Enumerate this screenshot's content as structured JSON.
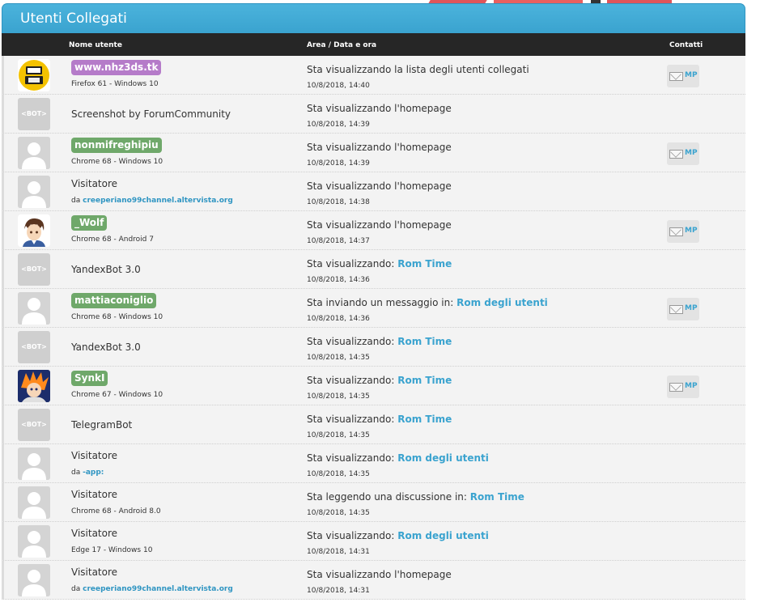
{
  "panel": {
    "title": "Utenti Collegati"
  },
  "headers": {
    "user": "Nome utente",
    "area": "Area / Data e ora",
    "contacts": "Contatti"
  },
  "colors": {
    "accent": "#3aa3cf",
    "purple_badge": "#b57bc9",
    "green_badge": "#6fa86a",
    "header_bg": "#262626"
  },
  "rows": [
    {
      "avatar": "3ds-icon",
      "name": "www.nhz3ds.tk",
      "sub": "Firefox 61 - Windows 10",
      "action": "Sta visualizzando la lista degli utenti collegati",
      "link": "",
      "time": "10/8/2018, 14:40",
      "mp": "MP"
    },
    {
      "avatar": "bot",
      "bot_label": "<BOT>",
      "name": "Screenshot by ForumCommunity",
      "sub": "",
      "action": "Sta visualizzando l'homepage",
      "link": "",
      "time": "10/8/2018, 14:39"
    },
    {
      "avatar": "default",
      "name": "nonmifreghipiu",
      "sub": "Chrome 68 - Windows 10",
      "action": "Sta visualizzando l'homepage",
      "link": "",
      "time": "10/8/2018, 14:39",
      "mp": "MP"
    },
    {
      "avatar": "default",
      "name": "Visitatore",
      "sub_prefix": "da",
      "sub_origin": "creeperiano99channel.altervista.org",
      "action": "Sta visualizzando l'homepage",
      "link": "",
      "time": "10/8/2018, 14:38"
    },
    {
      "avatar": "anime-boy",
      "name": "_Wolf",
      "sub": "Chrome 68 - Android 7",
      "action": "Sta visualizzando l'homepage",
      "link": "",
      "time": "10/8/2018, 14:37",
      "mp": "MP"
    },
    {
      "avatar": "bot",
      "bot_label": "<BOT>",
      "name": "YandexBot 3.0",
      "sub": "",
      "action": "Sta visualizzando:",
      "link": "Rom Time",
      "time": "10/8/2018, 14:36"
    },
    {
      "avatar": "default",
      "name": "mattiaconiglio",
      "sub": "Chrome 68 - Windows 10",
      "action": "Sta inviando un messaggio in:",
      "link": "Rom degli utenti",
      "time": "10/8/2018, 14:36",
      "mp": "MP"
    },
    {
      "avatar": "bot",
      "bot_label": "<BOT>",
      "name": "YandexBot 3.0",
      "sub": "",
      "action": "Sta visualizzando:",
      "link": "Rom Time",
      "time": "10/8/2018, 14:35"
    },
    {
      "avatar": "anime-orange",
      "name": "SynkI",
      "sub": "Chrome 67 - Windows 10",
      "action": "Sta visualizzando:",
      "link": "Rom Time",
      "time": "10/8/2018, 14:35",
      "mp": "MP"
    },
    {
      "avatar": "bot",
      "bot_label": "<BOT>",
      "name": "TelegramBot",
      "sub": "",
      "action": "Sta visualizzando:",
      "link": "Rom Time",
      "time": "10/8/2018, 14:35"
    },
    {
      "avatar": "default",
      "name": "Visitatore",
      "sub_prefix": "da",
      "sub_origin": "-app:",
      "action": "Sta visualizzando:",
      "link": "Rom degli utenti",
      "time": "10/8/2018, 14:35"
    },
    {
      "avatar": "default",
      "name": "Visitatore",
      "sub": "Chrome 68 - Android 8.0",
      "action": "Sta leggendo una discussione in:",
      "link": "Rom Time",
      "time": "10/8/2018, 14:35"
    },
    {
      "avatar": "default",
      "name": "Visitatore",
      "sub": "Edge 17 - Windows 10",
      "action": "Sta visualizzando:",
      "link": "Rom degli utenti",
      "time": "10/8/2018, 14:31"
    },
    {
      "avatar": "default",
      "name": "Visitatore",
      "sub_prefix": "da",
      "sub_origin": "creeperiano99channel.altervista.org",
      "action": "Sta visualizzando l'homepage",
      "link": "",
      "time": "10/8/2018, 14:31"
    }
  ]
}
